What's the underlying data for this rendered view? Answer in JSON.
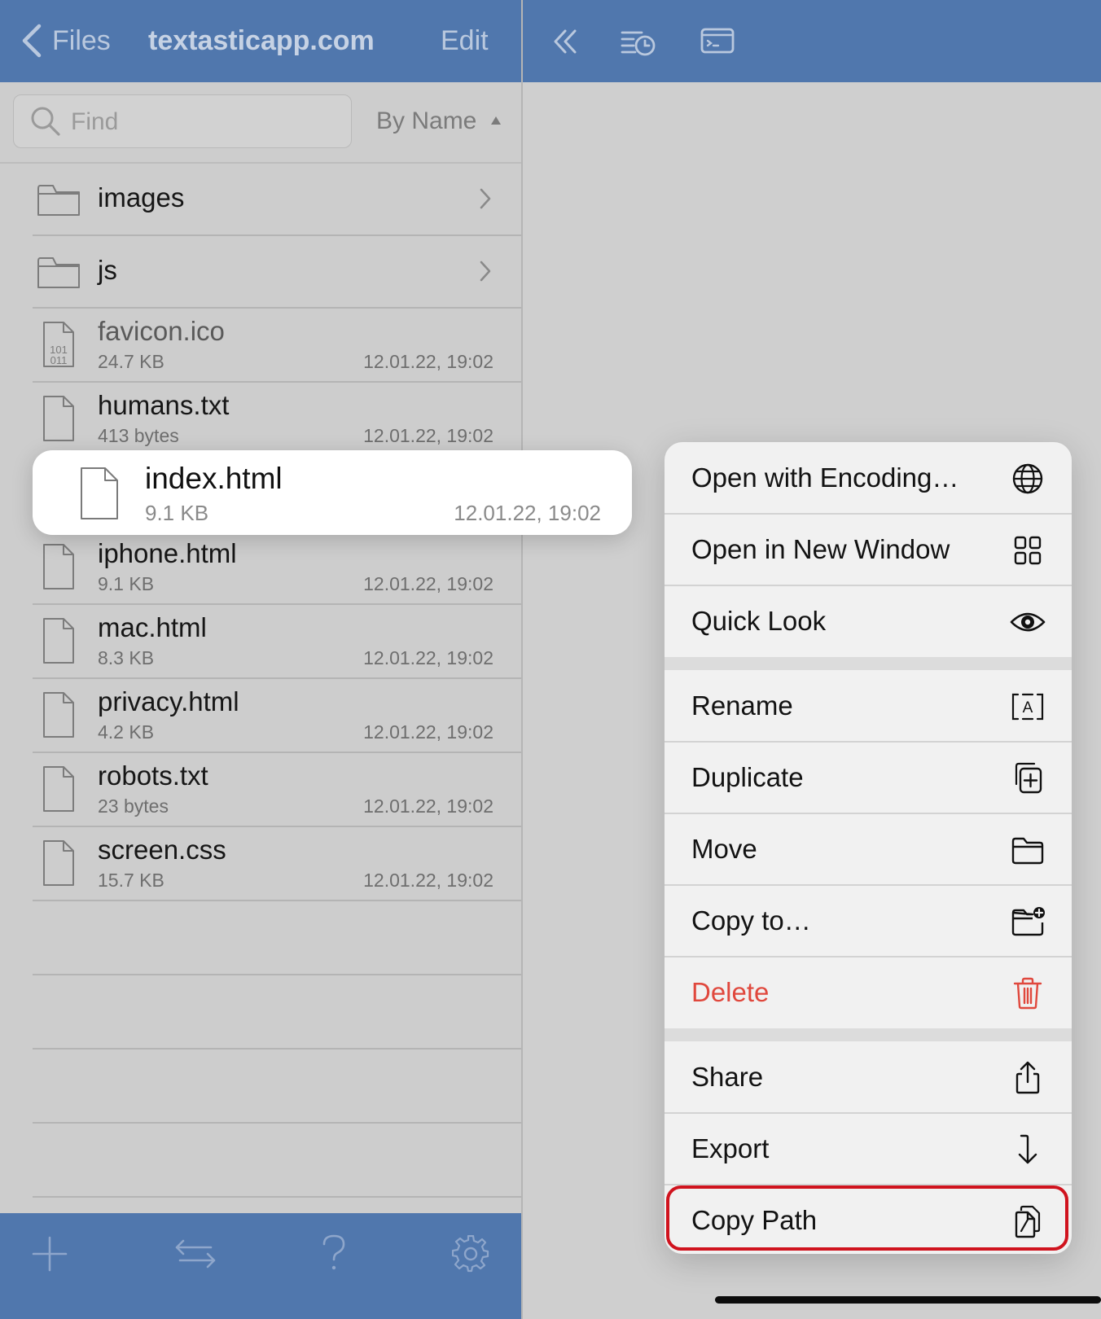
{
  "header": {
    "back_label": "Files",
    "title": "textasticapp.com",
    "edit_label": "Edit"
  },
  "search": {
    "placeholder": "Find"
  },
  "sort": {
    "label": "By Name"
  },
  "folders": [
    {
      "name": "images"
    },
    {
      "name": "js"
    }
  ],
  "files": [
    {
      "name": "favicon.ico",
      "size": "24.7 KB",
      "date": "12.01.22, 19:02",
      "icon": "binary-file-icon"
    },
    {
      "name": "humans.txt",
      "size": "413 bytes",
      "date": "12.01.22, 19:02",
      "icon": "file-icon"
    },
    {
      "name": "index.html",
      "size": "9.1 KB",
      "date": "12.01.22, 19:02",
      "icon": "file-icon"
    },
    {
      "name": "iphone.html",
      "size": "9.1 KB",
      "date": "12.01.22, 19:02",
      "icon": "file-icon"
    },
    {
      "name": "mac.html",
      "size": "8.3 KB",
      "date": "12.01.22, 19:02",
      "icon": "file-icon"
    },
    {
      "name": "privacy.html",
      "size": "4.2 KB",
      "date": "12.01.22, 19:02",
      "icon": "file-icon"
    },
    {
      "name": "robots.txt",
      "size": "23 bytes",
      "date": "12.01.22, 19:02",
      "icon": "file-icon"
    },
    {
      "name": "screen.css",
      "size": "15.7 KB",
      "date": "12.01.22, 19:02",
      "icon": "file-icon"
    }
  ],
  "context_menu": {
    "items": [
      {
        "label": "Open with Encoding…",
        "icon": "globe-icon"
      },
      {
        "label": "Open in New Window",
        "icon": "grid-icon"
      },
      {
        "label": "Quick Look",
        "icon": "eye-icon"
      },
      {
        "label": "Rename",
        "icon": "rename-icon"
      },
      {
        "label": "Duplicate",
        "icon": "duplicate-icon"
      },
      {
        "label": "Move",
        "icon": "folder-icon"
      },
      {
        "label": "Copy to…",
        "icon": "folder-plus-icon"
      },
      {
        "label": "Delete",
        "icon": "trash-icon"
      },
      {
        "label": "Share",
        "icon": "share-icon"
      },
      {
        "label": "Export",
        "icon": "export-arrow-icon"
      },
      {
        "label": "Copy Path",
        "icon": "copy-path-icon"
      }
    ]
  },
  "colors": {
    "nav_blue": "#5077ad",
    "destructive": "#e0483d",
    "highlight_border": "#d0131e"
  }
}
